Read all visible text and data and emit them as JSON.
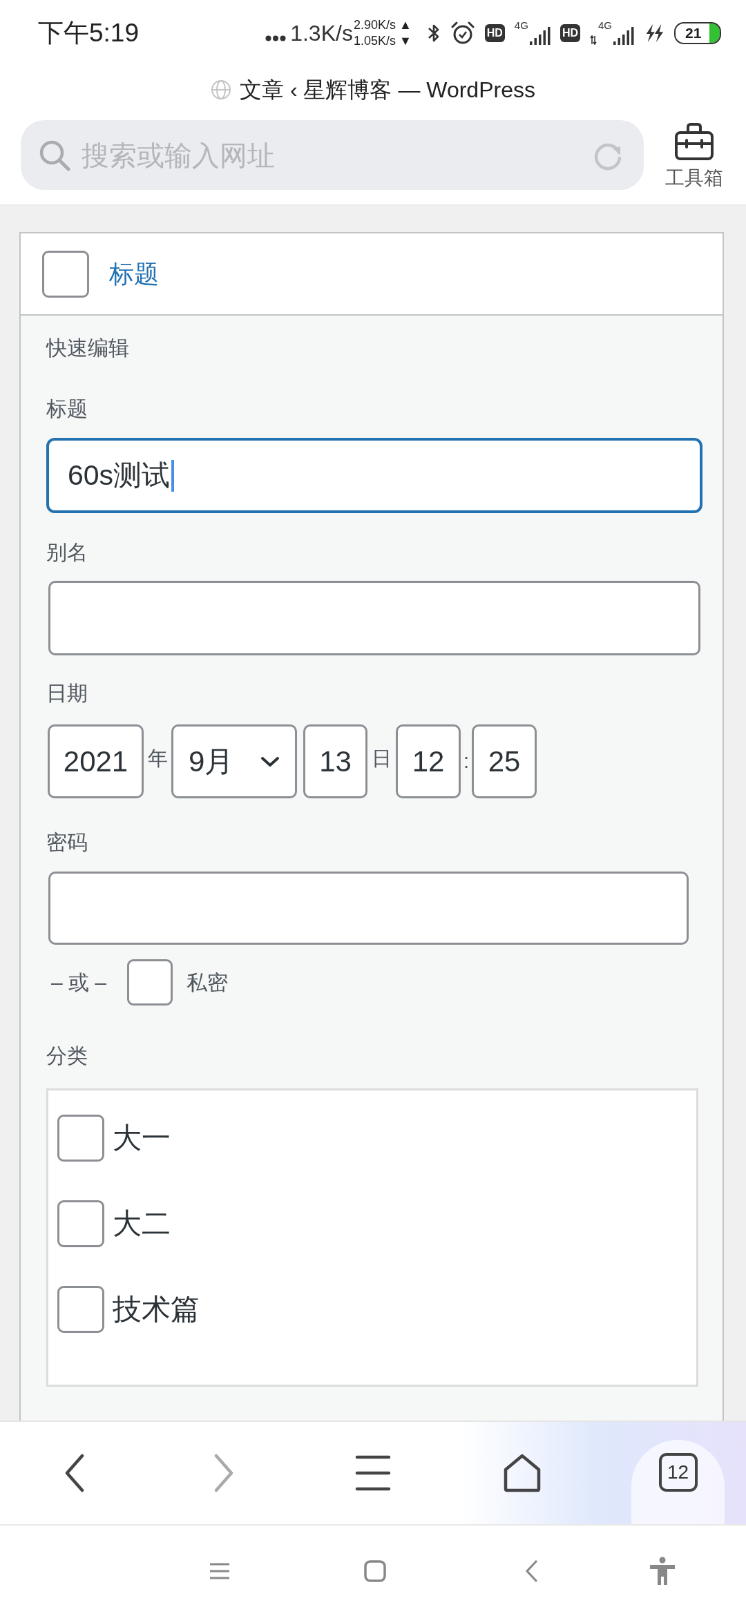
{
  "status_bar": {
    "time": "下午5:19",
    "net_speed": "1.3K/s",
    "upload_speed": "2.90K/s ▲",
    "download_speed": "1.05K/s ▼",
    "sims": [
      {
        "badge": "HD",
        "network": "4G",
        "data_active": false
      },
      {
        "badge": "HD",
        "network": "4G",
        "data_active": true
      }
    ],
    "battery": "21"
  },
  "browser": {
    "page_title": "文章 ‹ 星辉博客 — WordPress",
    "address_placeholder": "搜索或输入网址",
    "toolbox_label": "工具箱"
  },
  "post_row": {
    "checked": false,
    "title": "标题"
  },
  "quick_edit": {
    "heading": "快速编辑",
    "title_field": {
      "label": "标题",
      "value": "60s测试",
      "focused": true
    },
    "slug_field": {
      "label": "别名",
      "focused": false
    },
    "date": {
      "label": "日期",
      "year": "2021",
      "year_unit": "年",
      "month": "9月",
      "day": "13",
      "day_unit": "日",
      "hour": "12",
      "time_separator": ":",
      "minute": "25"
    },
    "password_field": {
      "label": "密码",
      "focused": false
    },
    "private": {
      "separator": "– 或 –",
      "checked": false,
      "label": "私密"
    },
    "categories": {
      "label": "分类",
      "items": [
        {
          "label": "大一",
          "checked": false
        },
        {
          "label": "大二",
          "checked": false
        },
        {
          "label": "技术篇",
          "checked": false
        }
      ]
    }
  },
  "browser_toolbar": {
    "back_disabled": false,
    "forward_disabled": true,
    "tab_count": "12"
  }
}
